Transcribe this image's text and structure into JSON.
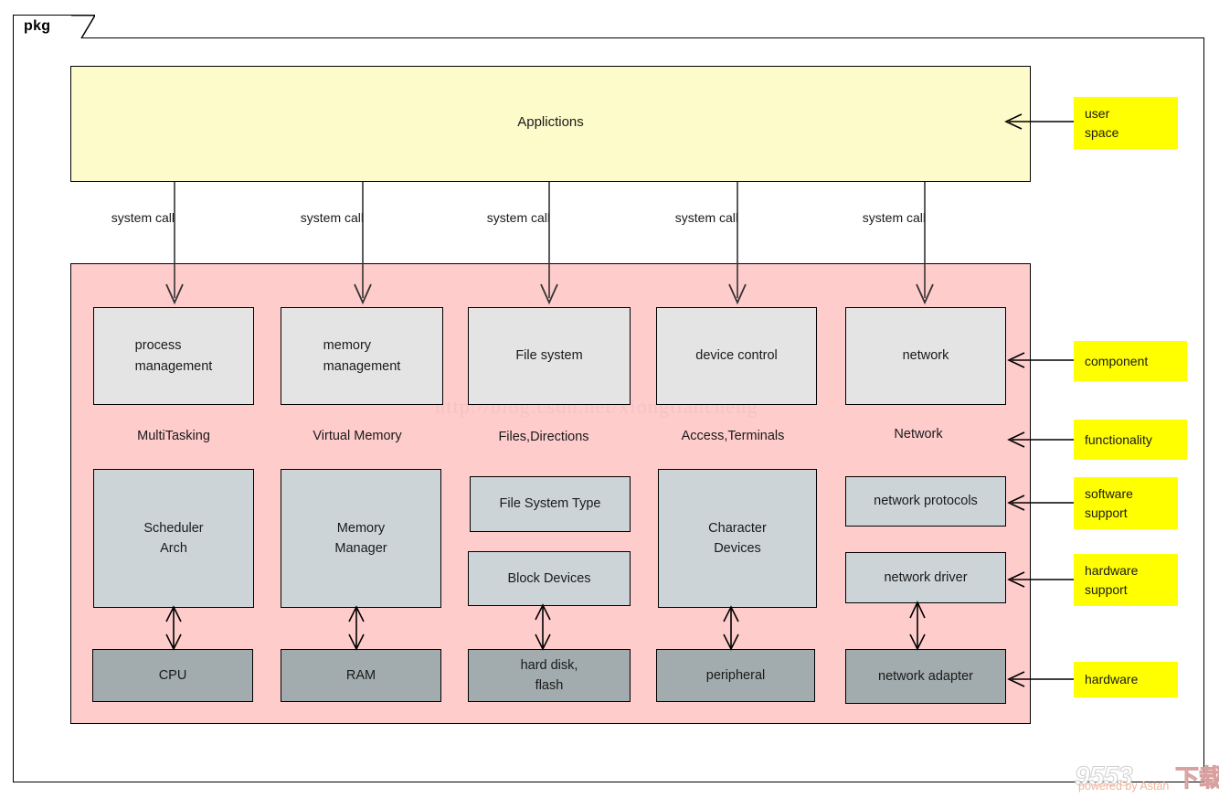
{
  "frame": {
    "tab_label": "pkg"
  },
  "userspace": {
    "label": "Applictions"
  },
  "syscalls": [
    {
      "label": "system call"
    },
    {
      "label": "system call"
    },
    {
      "label": "system call"
    },
    {
      "label": "system call"
    },
    {
      "label": "system call"
    }
  ],
  "components": [
    {
      "label": "process\nmanagement"
    },
    {
      "label": "memory\nmanagement"
    },
    {
      "label": "File system"
    },
    {
      "label": "device control"
    },
    {
      "label": "network"
    }
  ],
  "functionality": [
    {
      "label": "MultiTasking"
    },
    {
      "label": "Virtual Memory"
    },
    {
      "label": "Files,Directions"
    },
    {
      "label": "Access,Terminals"
    },
    {
      "label": "Network"
    }
  ],
  "software_support": [
    {
      "label": "Scheduler\nArch"
    },
    {
      "label": "Memory\nManager"
    },
    {
      "label": "File System Type"
    },
    {
      "label": "Block Devices"
    },
    {
      "label": "Character\nDevices"
    },
    {
      "label": "network protocols"
    },
    {
      "label": "network driver"
    }
  ],
  "hardware": [
    {
      "label": "CPU"
    },
    {
      "label": "RAM"
    },
    {
      "label": "hard disk,\nflash"
    },
    {
      "label": "peripheral"
    },
    {
      "label": "network adapter"
    }
  ],
  "annotations": [
    {
      "label": "user\nspace"
    },
    {
      "label": "component"
    },
    {
      "label": "functionality"
    },
    {
      "label": "software\nsupport"
    },
    {
      "label": "hardware\nsupport"
    },
    {
      "label": "hardware"
    }
  ],
  "watermarks": {
    "center": "http://blog.csdn.net/xiongtiancheng",
    "corner_big": "9553",
    "corner_small": "powered by Astah",
    "corner_cjk": "下载"
  },
  "colors": {
    "userspace_fill": "#fdfbca",
    "kernel_fill": "#ffcccc",
    "component_fill": "#e4e4e4",
    "software_fill": "#ccd4d8",
    "hardware_fill": "#a2abad",
    "annotation_fill": "#ffff00",
    "stroke": "#000000"
  }
}
